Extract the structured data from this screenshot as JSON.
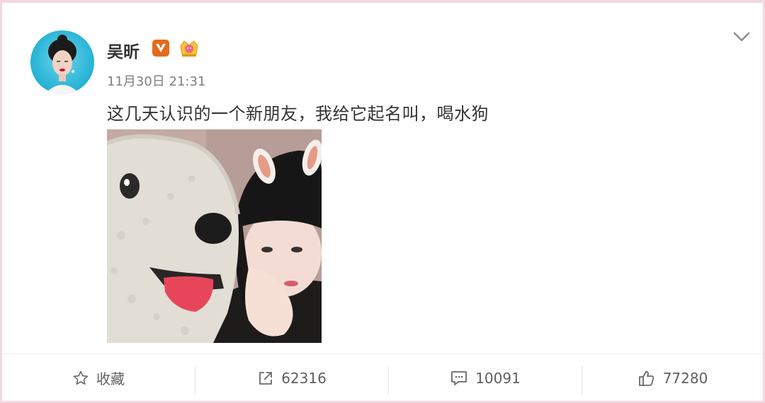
{
  "post": {
    "author": "吴昕",
    "timestamp": "11月30日 21:31",
    "text": "这几天认识的一个新朋友，我给它起名叫，喝水狗"
  },
  "badges": {
    "verified": "verified-v-badge",
    "member": "crown-member-badge"
  },
  "actions": {
    "favorite_label": "收藏",
    "repost_count": "62316",
    "comment_count": "10091",
    "like_count": "77280"
  },
  "colors": {
    "frame_border": "#f3d9e1",
    "verified_badge": "#e36a1a",
    "text_primary": "#333333",
    "text_secondary": "#808080"
  }
}
